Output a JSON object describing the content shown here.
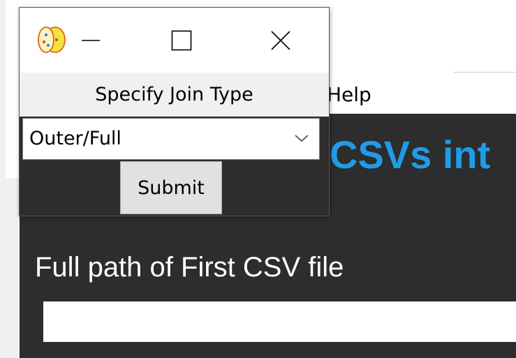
{
  "background_window": {
    "menu_help": "Help",
    "heading": "CSVs int",
    "field_label": "Full path of First CSV file",
    "path_input_value": ""
  },
  "dialog": {
    "icon": "app-icon",
    "minimize_icon": "minimize-icon",
    "maximize_icon": "maximize-icon",
    "close_icon": "close-icon",
    "label": "Specify Join Type",
    "join_type_selected": "Outer/Full",
    "dropdown_icon": "chevron-down-icon",
    "submit_label": "Submit"
  },
  "colors": {
    "accent_heading": "#1f9ce8",
    "dark_background": "#2d2d2d",
    "dialog_label_background": "#f0f0f0",
    "button_background": "#e1e1e1"
  }
}
